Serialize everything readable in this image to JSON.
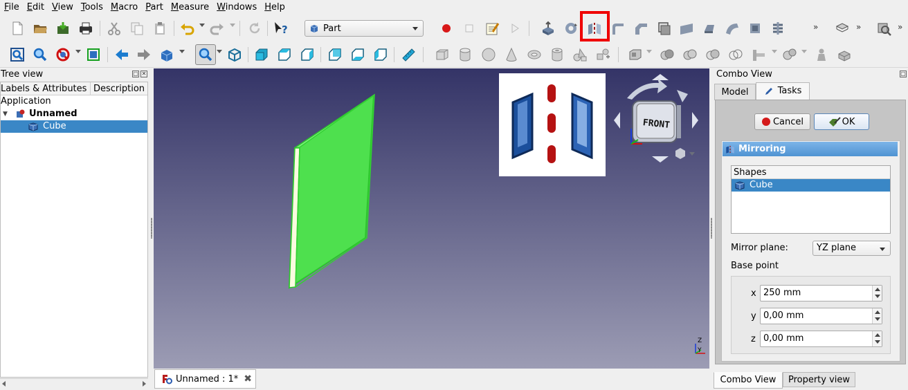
{
  "menu": [
    "File",
    "Edit",
    "View",
    "Tools",
    "Macro",
    "Part",
    "Measure",
    "Windows",
    "Help"
  ],
  "workbench": {
    "label": "Part"
  },
  "overflow": {
    "chevron": "»"
  },
  "toolbar_icons": {
    "row1": [
      "new-document-icon",
      "open-icon",
      "save-icon",
      "print-icon",
      "cut-icon",
      "copy-icon",
      "paste-icon",
      "undo-icon",
      "redo-icon",
      "refresh-icon",
      "whats-this-icon",
      "macro-record-icon",
      "macro-stop-icon",
      "macro-edit-icon",
      "macro-run-icon",
      "extrude-icon",
      "revolve-icon",
      "mirror-icon",
      "fillet-icon",
      "chamfer-icon",
      "make-face-icon",
      "ruled-surface-icon",
      "loft-icon",
      "sweep-icon",
      "section-icon",
      "cross-sections-icon",
      "offset-icon",
      "thickness-icon"
    ],
    "row2": [
      "fit-all-icon",
      "fit-selection-icon",
      "draw-style-icon",
      "bounding-box-icon",
      "back-icon",
      "forward-icon",
      "sync-view-icon",
      "zoom-icon",
      "isometric-icon",
      "front-view-icon",
      "top-view-icon",
      "right-view-icon",
      "rear-view-icon",
      "bottom-view-icon",
      "left-view-icon",
      "measure-icon",
      "box-icon",
      "cylinder-icon",
      "sphere-icon",
      "cone-icon",
      "torus-icon",
      "tube-icon",
      "primitives-icon",
      "shape-builder-icon",
      "boolean-icon",
      "cut-boolean-icon",
      "fuse-icon",
      "common-icon",
      "split-icon",
      "compound-icon",
      "check-geometry-icon",
      "defeaturing-icon"
    ]
  },
  "tree_view": {
    "title": "Tree view",
    "columns": [
      "Labels & Attributes",
      "Description"
    ],
    "items": [
      {
        "label": "Application",
        "level": 0
      },
      {
        "label": "Unnamed",
        "level": 1
      },
      {
        "label": "Cube",
        "level": 2
      }
    ]
  },
  "viewport": {
    "navcube_face": "FRONT",
    "axis_labels": {
      "z": "Z",
      "y": "Y"
    }
  },
  "document_tab": {
    "label": "Unnamed : 1*"
  },
  "combo_view": {
    "title": "Combo View",
    "tabs": [
      "Model",
      "Tasks"
    ],
    "active_tab": "Tasks",
    "cancel_label": "Cancel",
    "ok_label": "OK",
    "mirroring": {
      "title": "Mirroring",
      "shapes_header": "Shapes",
      "shapes": [
        "Cube"
      ],
      "mirror_plane_label": "Mirror plane:",
      "mirror_plane_value": "YZ plane",
      "base_point_label": "Base point",
      "x_label": "x",
      "x_value": "250 mm",
      "y_label": "y",
      "y_value": "0,00 mm",
      "z_label": "z",
      "z_value": "0,00 mm"
    },
    "bottom_tabs": [
      "Combo View",
      "Property view"
    ]
  },
  "colors": {
    "highlight": "#ef0000",
    "selection": "#3a87c6",
    "selected_object": "#4fe34f",
    "panel_header": "#5b9bd8"
  }
}
